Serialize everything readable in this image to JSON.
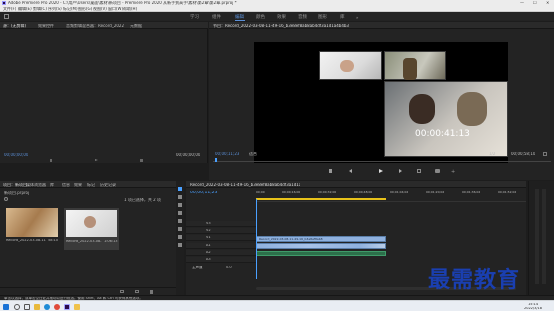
{
  "window": {
    "title": "Adobe Premiere Pro 2020 - C:\\用户\\Users\\桌面\\素材\\新项目 - Premiere Pro 2020 从新手到高手\\素材\\第2章\\第2章.prproj *",
    "controls": [
      "—",
      "☐",
      "✕"
    ]
  },
  "menu": [
    "文件(F)",
    "编辑(E)",
    "剪辑(C)",
    "序列(S)",
    "标记(M)",
    "图形(G)",
    "视图(V)",
    "窗口(W)",
    "帮助(H)"
  ],
  "workspaces": {
    "items": [
      "学习",
      "组件",
      "编辑",
      "颜色",
      "效果",
      "音频",
      "图形",
      "库"
    ],
    "active": "编辑"
  },
  "source_panel": {
    "tabs": [
      "源：(无剪辑)",
      "效果控件",
      "音频剪辑混合器：Record_2022",
      "元数据"
    ],
    "timecode_left": "00;00;00;00",
    "timecode_right": "00;00;00;00"
  },
  "program_panel": {
    "title": "节目：Record_2022-03-08-11-49-16_b3e8ef8ab8ab4df3a1d1a4b4b3",
    "timecode_left": "00;00;11;23",
    "fit": "适合",
    "quality": "1/2",
    "timecode_right": "00;00;58;10",
    "video_overlay_time": "00:00:41:13"
  },
  "project_panel": {
    "tabs": [
      "项目：新项目",
      "媒体浏览器",
      "库",
      "信息",
      "效果",
      "标记",
      "历史记录"
    ],
    "project_file": "新项目.prproj",
    "item_count": "1 项已选择，共 2 项",
    "items": [
      {
        "name": "Record_2022-03-08-11-49-16_b3e...",
        "duration": "58:10",
        "kind": "paper"
      },
      {
        "name": "Record_2022-03-08-11-49-16_b3e...",
        "duration": "1:06:13",
        "kind": "boy"
      }
    ]
  },
  "timeline": {
    "title": "Record_2022-03-08-11-49-16_b3e8ef8ab8ab4df3a1d1a4b4b3",
    "timecode": "00;00;11;23",
    "ruler": [
      "00;00",
      "00;00;16;00",
      "00;00;32;00",
      "00;00;48;00",
      "00;01;04;02",
      "00;01;20;02",
      "00;01;36;02",
      "00;01;52;02"
    ],
    "video_tracks": [
      "V3",
      "V2",
      "V1"
    ],
    "audio_tracks": [
      "A1",
      "A2",
      "A3"
    ],
    "master": "主声道",
    "master_value": "0.0",
    "clip_label": "Record_2022-03-08-11-49-16_b3e8ef8ab8"
  },
  "status": "单击以选择，或单击空白处并拖动以进行框选。使用 Shift、Alt 和 Ctrl 可获得其他选项。",
  "watermark": "最需教育",
  "taskbar": {
    "time": "15:14",
    "date": "2022/3/18",
    "icons": [
      "start",
      "search",
      "taskview",
      "explorer",
      "edge",
      "chrome",
      "premiere",
      "folder"
    ]
  },
  "colors": {
    "accent": "#2d8ceb",
    "playhead": "#4aa0ff",
    "clip_blue": "#8fb1de",
    "watermark": "#1a3fb0"
  }
}
